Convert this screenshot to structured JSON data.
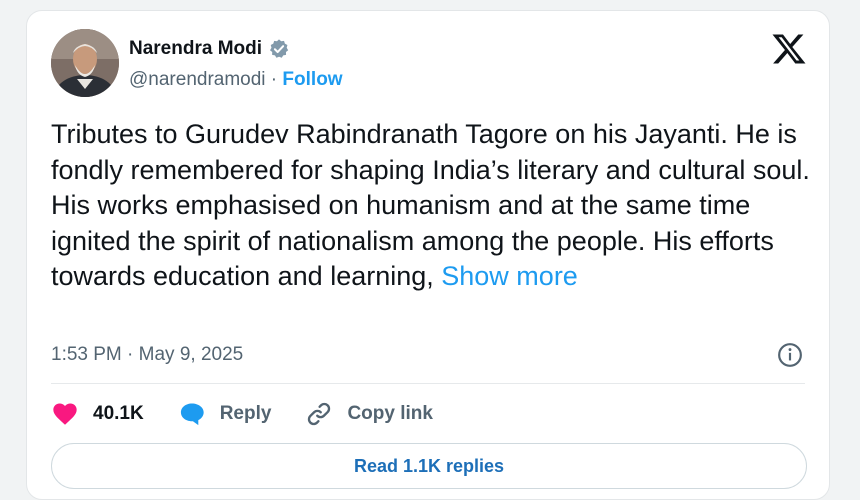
{
  "author": {
    "name": "Narendra Modi",
    "handle": "@narendramodi",
    "separator": " · ",
    "follow_label": "Follow"
  },
  "tweet": {
    "text": "Tributes to Gurudev Rabindranath Tagore on his Jayanti. He is fondly remembered for shaping India’s literary and cultural soul. His works emphasised on humanism and at the same time ignited the spirit of nationalism among the people. His efforts towards education and learning, ",
    "show_more_label": "Show more",
    "timestamp": "1:53 PM · May 9, 2025"
  },
  "actions": {
    "likes": "40.1K",
    "reply_label": "Reply",
    "copy_link_label": "Copy link"
  },
  "replies_button_label": "Read 1.1K replies",
  "colors": {
    "accent": "#1d9bf0",
    "like": "#f91880",
    "reply": "#1d9bf0",
    "muted": "#536471"
  },
  "icons": [
    "verified-badge-icon",
    "x-logo-icon",
    "info-icon",
    "heart-icon",
    "reply-bubble-icon",
    "link-icon"
  ]
}
